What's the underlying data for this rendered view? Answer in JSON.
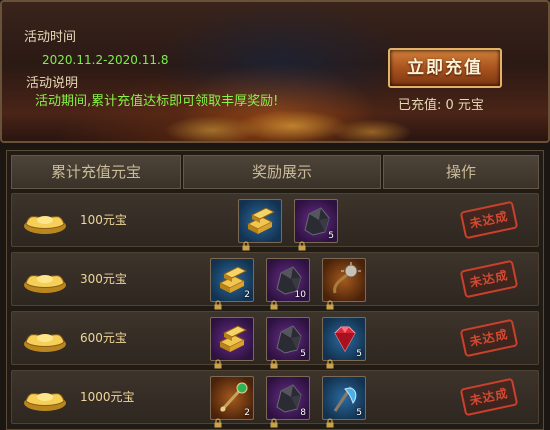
{
  "banner": {
    "time_label": "活动时间",
    "dates": "2020.11.2-2020.11.8",
    "desc_label": "活动说明",
    "desc_text": "活动期间,累计充值达标即可领取丰厚奖励!",
    "recharge_button": "立即充值",
    "recharged_text": "已充值: 0 元宝"
  },
  "table": {
    "headers": [
      "累计充值元宝",
      "奖励展示",
      "操作"
    ],
    "rows": [
      {
        "amount": "100元宝",
        "status": "未达成",
        "rewards": [
          {
            "icon": "gold-bars-icon",
            "rarity": "blue",
            "count": ""
          },
          {
            "icon": "black-ore-icon",
            "rarity": "purple",
            "count": "5"
          }
        ]
      },
      {
        "amount": "300元宝",
        "status": "未达成",
        "rewards": [
          {
            "icon": "gold-bars-icon",
            "rarity": "blue",
            "count": "2"
          },
          {
            "icon": "black-ore-icon",
            "rarity": "purple",
            "count": "10"
          },
          {
            "icon": "spiked-whip-icon",
            "rarity": "orange",
            "count": ""
          }
        ]
      },
      {
        "amount": "600元宝",
        "status": "未达成",
        "rewards": [
          {
            "icon": "gold-bars-icon",
            "rarity": "purple",
            "count": ""
          },
          {
            "icon": "black-ore-icon",
            "rarity": "purple",
            "count": "5"
          },
          {
            "icon": "red-gem-icon",
            "rarity": "blue",
            "count": "5"
          }
        ]
      },
      {
        "amount": "1000元宝",
        "status": "未达成",
        "rewards": [
          {
            "icon": "jeweled-scepter-icon",
            "rarity": "orange",
            "count": "2"
          },
          {
            "icon": "black-ore-icon",
            "rarity": "purple",
            "count": "8"
          },
          {
            "icon": "blue-axe-icon",
            "rarity": "blue",
            "count": "5"
          }
        ]
      }
    ]
  }
}
